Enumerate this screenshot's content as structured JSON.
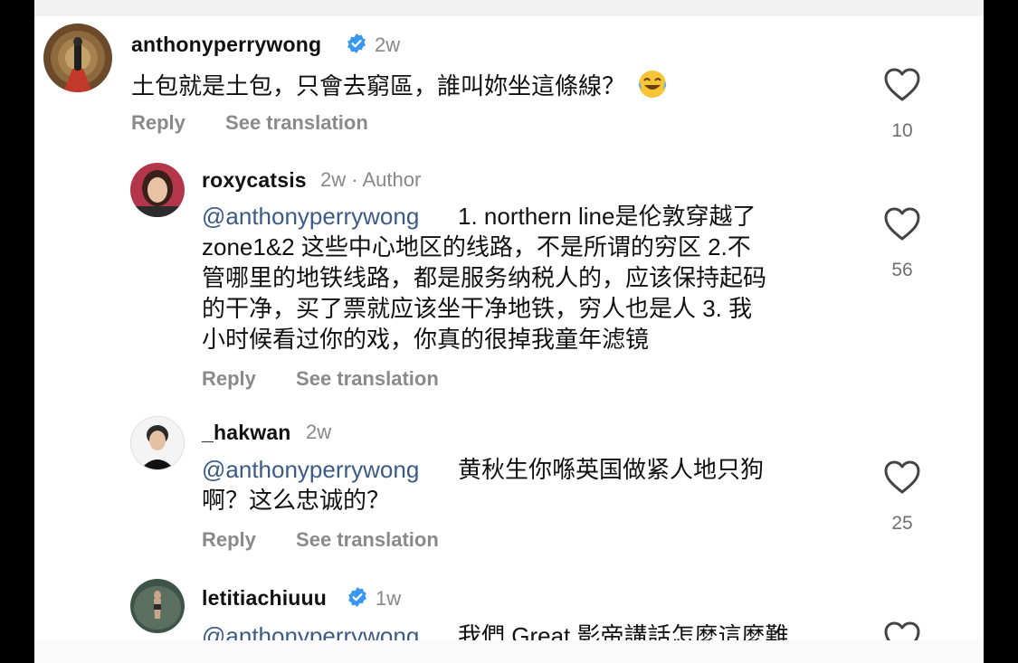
{
  "comments": [
    {
      "username": "anthonyperrywong",
      "verified": true,
      "time": "2w",
      "text": "土包就是土包，只會去窮區，誰叫妳坐這條線？",
      "emoji": "face-with-tears-of-joy",
      "reply_label": "Reply",
      "translate_label": "See translation",
      "likes": "10"
    },
    {
      "username": "roxycatsis",
      "time": "2w",
      "author_tag": "· Author",
      "mention": "@anthonyperrywong",
      "lines": [
        " 1. northern line是伦敦穿越了",
        "zone1&2 这些中心地区的线路，不是所谓的穷区 2.不",
        "管哪里的地铁线路，都是服务纳税人的，应该保持起码",
        "的干净，买了票就应该坐干净地铁，穷人也是人 3. 我",
        "小时候看过你的戏，你真的很掉我童年滤镜"
      ],
      "reply_label": "Reply",
      "translate_label": "See translation",
      "likes": "56"
    },
    {
      "username": "_hakwan",
      "time": "2w",
      "mention": "@anthonyperrywong",
      "lines": [
        " 黄秋生你喺英国做紧人地只狗",
        "啊？这么忠诚的？"
      ],
      "reply_label": "Reply",
      "translate_label": "See translation",
      "likes": "25"
    },
    {
      "username": "letitiachiuuu",
      "verified": true,
      "time": "1w",
      "mention": "@anthonyperrywong",
      "lines": [
        " 我們 Great 影帝講話怎麼這麼難"
      ]
    }
  ],
  "colors": {
    "mention": "#3b5a86",
    "verified": "#3897f0",
    "secondary_text": "#888888"
  }
}
